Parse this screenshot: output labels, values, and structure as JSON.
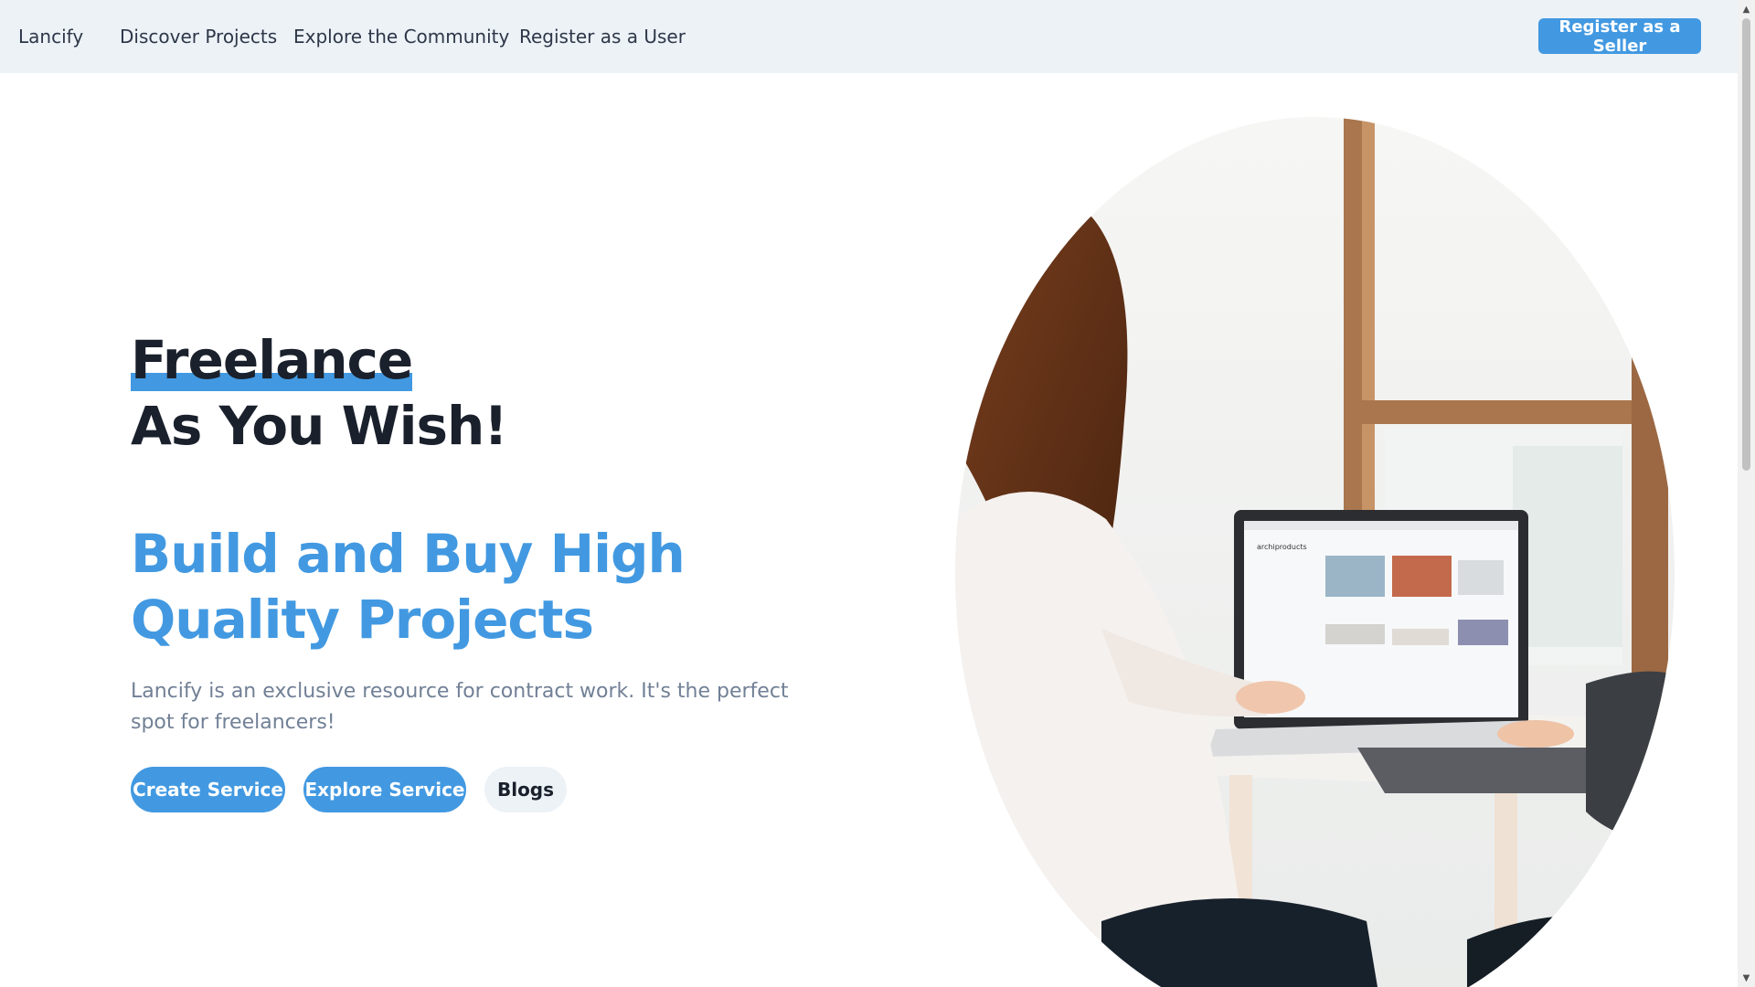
{
  "nav": {
    "brand": "Lancify",
    "links": [
      "Discover Projects",
      "Explore the Community",
      "Register as a User"
    ],
    "cta": "Register as a Seller"
  },
  "hero": {
    "title_highlight": "Freelance",
    "title_rest": "As You Wish!",
    "subtitle_line1": "Build and Buy High",
    "subtitle_line2": "Quality Projects",
    "description": "Lancify is an exclusive resource for contract work. It's the perfect spot for freelancers!",
    "buttons": {
      "create": "Create Service",
      "explore": "Explore Service",
      "blogs": "Blogs"
    }
  },
  "laptop_screen": {
    "site_name": "archiproducts"
  },
  "colors": {
    "accent": "#4299e1",
    "nav_bg": "#edf2f7",
    "heading": "#1a202c",
    "body_text": "#718096"
  }
}
